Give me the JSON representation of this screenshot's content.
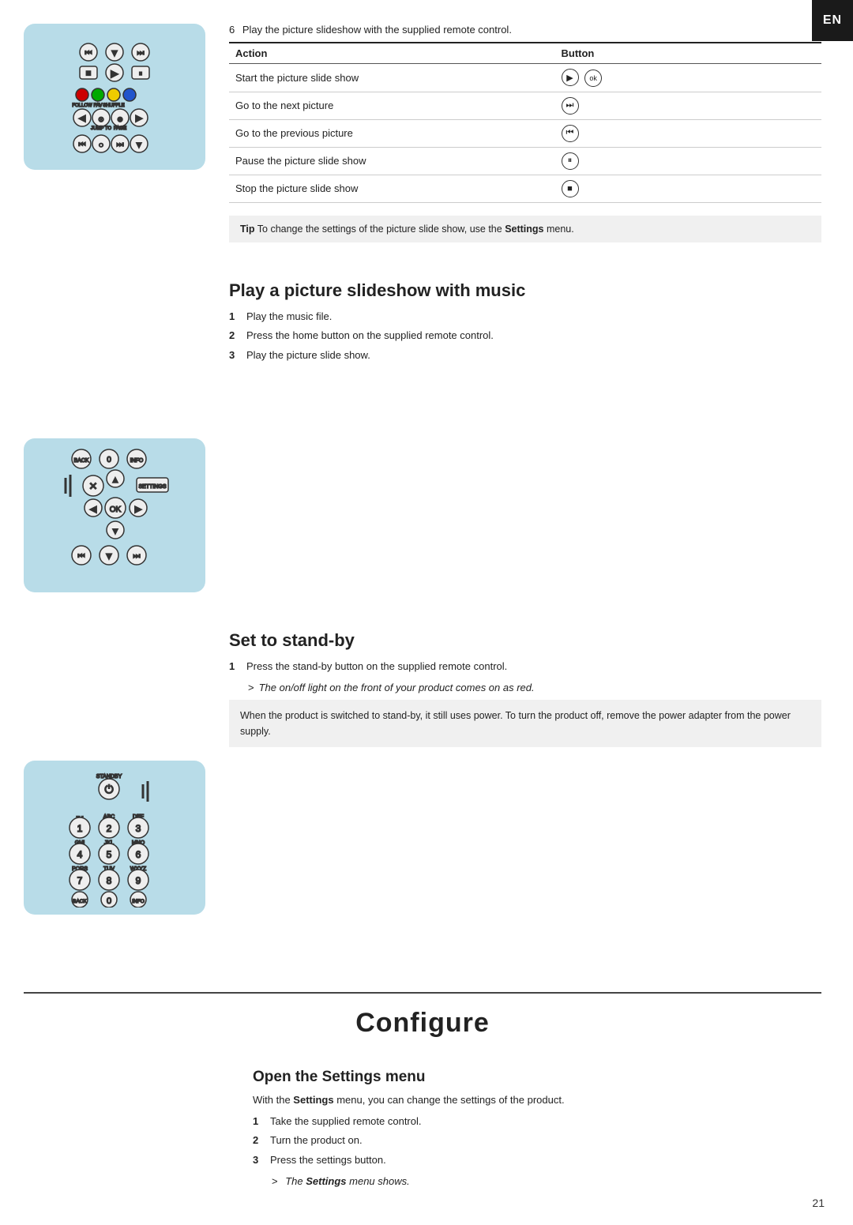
{
  "en_badge": "EN",
  "page_number": "21",
  "step6": {
    "num": "6",
    "text": "Play the picture slideshow with the supplied remote control."
  },
  "table": {
    "col1": "Action",
    "col2": "Button",
    "rows": [
      {
        "action": "Start the picture slide show",
        "button_type": "play_ok"
      },
      {
        "action": "Go to the next picture",
        "button_type": "next"
      },
      {
        "action": "Go to the previous picture",
        "button_type": "prev"
      },
      {
        "action": "Pause the picture slide show",
        "button_type": "pause"
      },
      {
        "action": "Stop the picture slide show",
        "button_type": "stop"
      }
    ]
  },
  "tip": {
    "label": "Tip",
    "text": "To change the settings of the picture slide show, use the",
    "bold": "Settings",
    "text2": "menu."
  },
  "section_slideshow": {
    "title": "Play a picture slideshow with music",
    "steps": [
      {
        "num": "1",
        "text": "Play the music file."
      },
      {
        "num": "2",
        "text": "Press the home button on the supplied remote control."
      },
      {
        "num": "3",
        "text": "Play the picture slide show."
      }
    ]
  },
  "section_standby": {
    "title": "Set to stand-by",
    "steps": [
      {
        "num": "1",
        "text": "Press the stand-by button on the supplied remote control."
      }
    ],
    "result": "The on/off light on the front of your product comes on as red.",
    "info": "When the product is switched to stand-by, it still uses power. To turn the product off, remove the power adapter from the power supply."
  },
  "configure_title": "Configure",
  "section_settings": {
    "title": "Open the Settings menu",
    "intro_pre": "With the ",
    "intro_bold": "Settings",
    "intro_post": " menu, you can change the settings of the product.",
    "steps": [
      {
        "num": "1",
        "text": "Take the supplied remote control."
      },
      {
        "num": "2",
        "text": "Turn the product on."
      },
      {
        "num": "3",
        "text": "Press the settings button."
      }
    ],
    "result_pre": "The ",
    "result_bold": "Settings",
    "result_post": " menu shows."
  }
}
